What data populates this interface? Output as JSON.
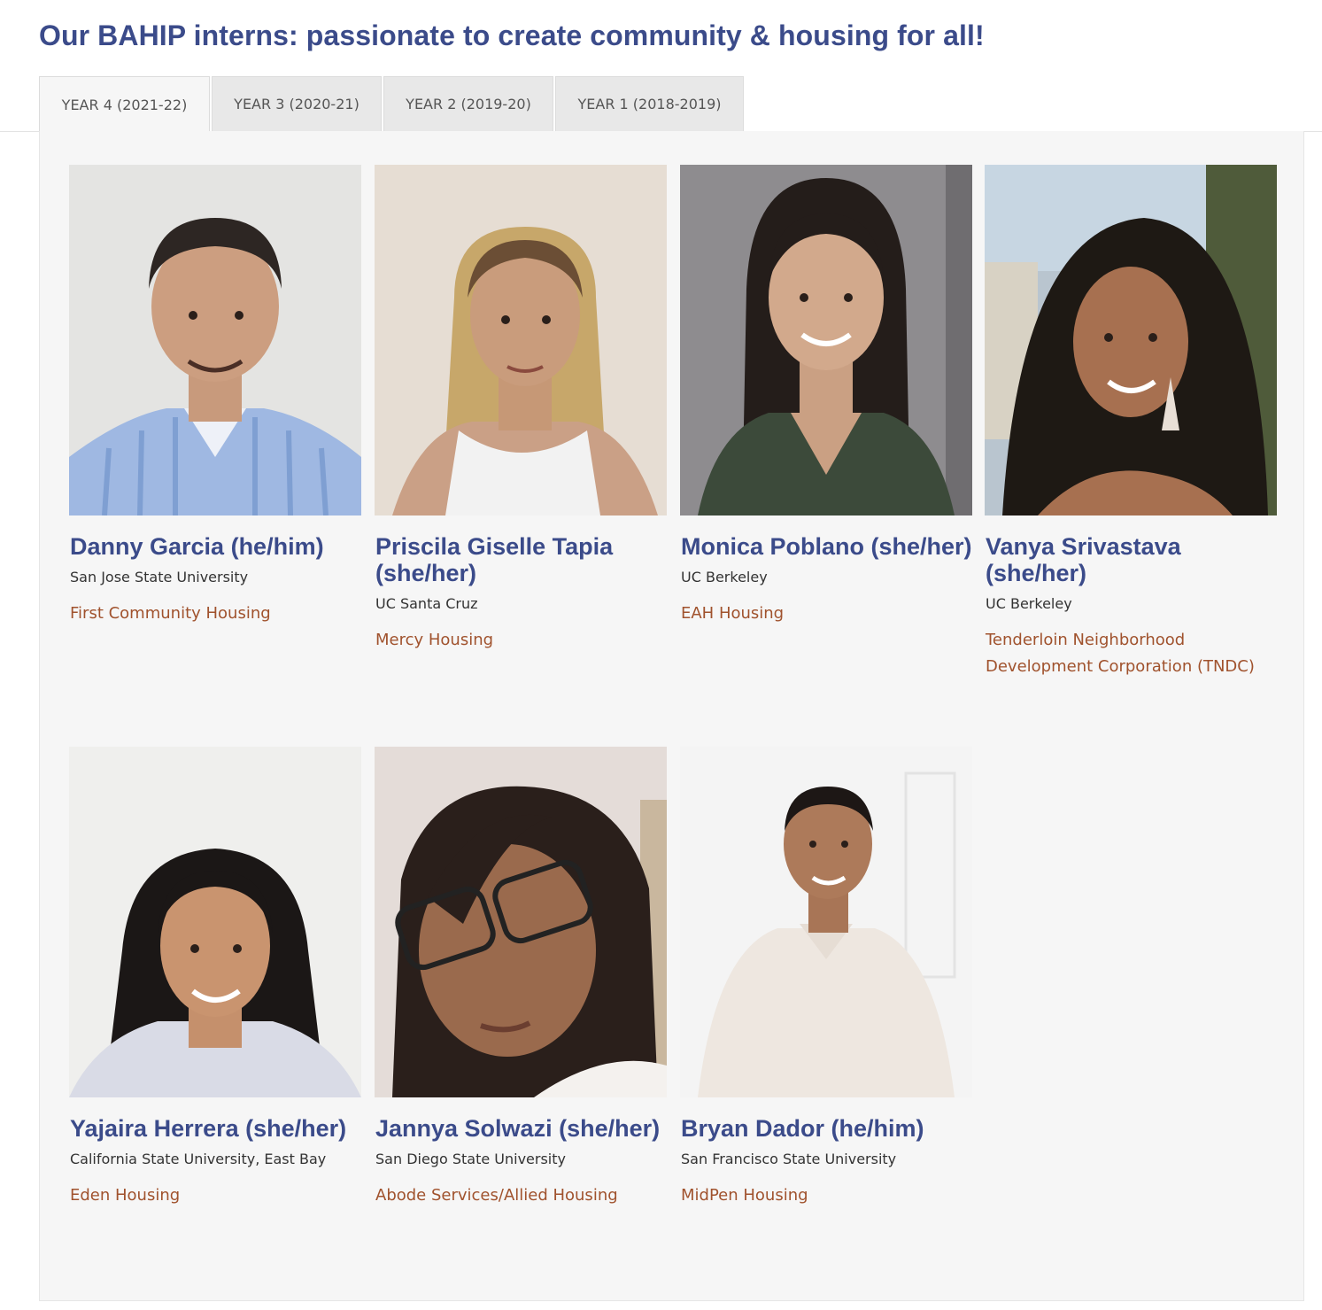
{
  "heading": "Our BAHIP interns: passionate to create community & housing for all!",
  "tabs": [
    {
      "label": "YEAR 4 (2021-22)"
    },
    {
      "label": "YEAR 3 (2020-21)"
    },
    {
      "label": "YEAR 2 (2019-20)"
    },
    {
      "label": "YEAR 1 (2018-2019)"
    }
  ],
  "active_tab": "YEAR 4 (2021-22)",
  "interns": [
    {
      "name": "Danny Garcia (he/him)",
      "school": "San Jose State University",
      "org": "First Community Housing"
    },
    {
      "name": "Priscila Giselle Tapia (she/her)",
      "school": "UC Santa Cruz",
      "org": "Mercy Housing"
    },
    {
      "name": "Monica Poblano (she/her)",
      "school": "UC Berkeley",
      "org": "EAH Housing"
    },
    {
      "name": "Vanya Srivastava (she/her)",
      "school": "UC Berkeley",
      "org": "Tenderloin Neighborhood Development Corporation (TNDC)"
    },
    {
      "name": "Yajaira Herrera (she/her)",
      "school": "California State University, East Bay",
      "org": "Eden Housing"
    },
    {
      "name": "Jannya Solwazi (she/her)",
      "school": "San Diego State University",
      "org": "Abode Services/Allied Housing"
    },
    {
      "name": "Bryan Dador (he/him)",
      "school": "San Francisco State University",
      "org": "MidPen Housing"
    }
  ],
  "colors": {
    "heading": "#3b4b8a",
    "name": "#3b4b8a",
    "org_link": "#a0522d",
    "panel_bg": "#f6f6f6",
    "tab_bg": "#e8e8e8"
  }
}
